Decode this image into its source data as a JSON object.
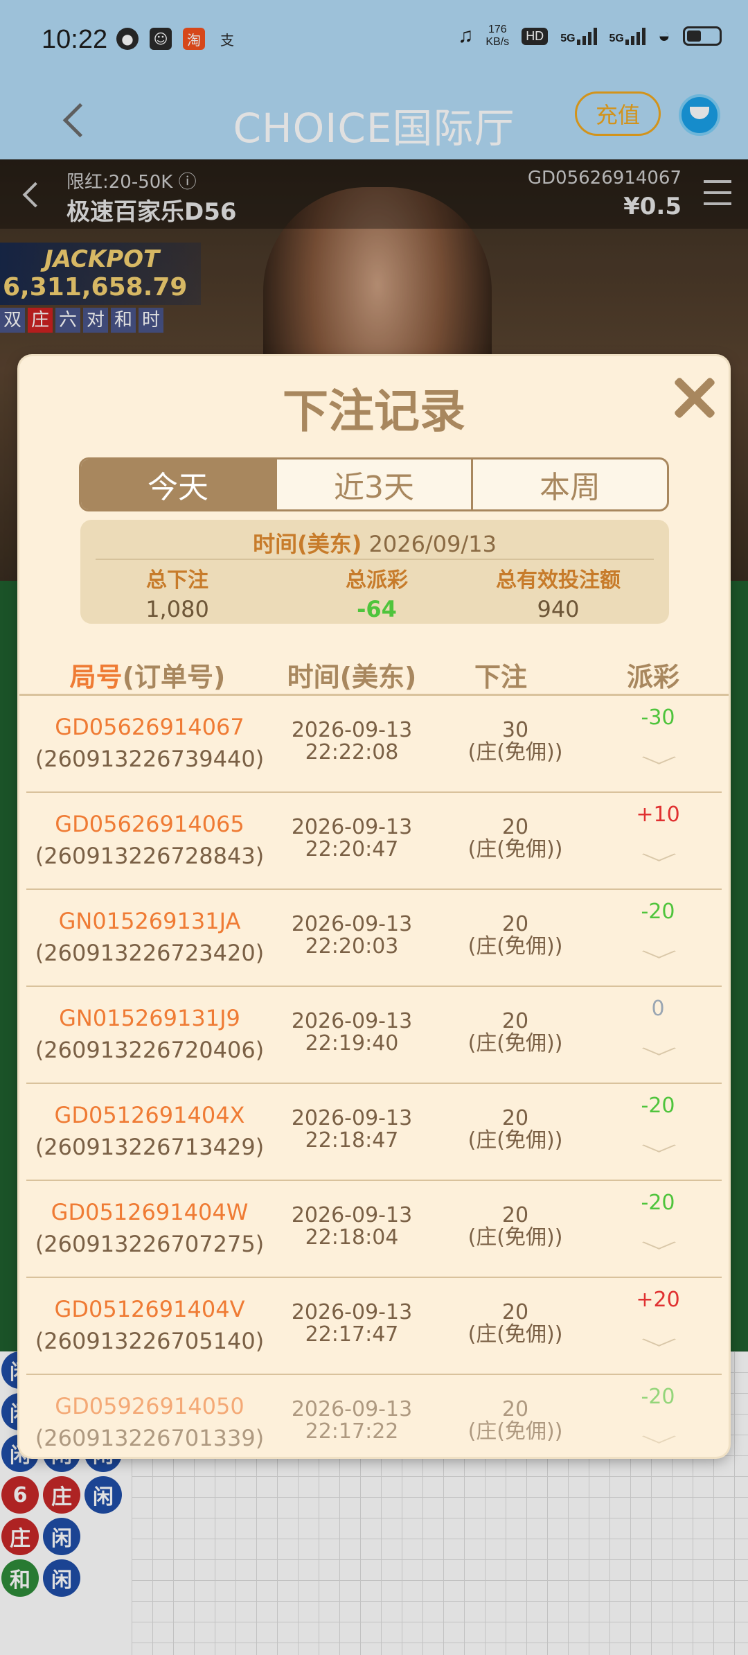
{
  "status_bar": {
    "time": "10:22",
    "net_speed_value": "176",
    "net_speed_unit": "KB/s",
    "hd_label": "HD",
    "signal1": "5G",
    "signal2": "5G"
  },
  "nav": {
    "title": "CHOICE国际厅",
    "recharge_label": "充值"
  },
  "game": {
    "limit": "限红:20-50K ⓘ",
    "table_name": "极速百家乐D56",
    "round_id": "GD05626914067",
    "balance": "¥0.5",
    "jackpot_label": "JACKPOT",
    "jackpot_amount": "6,311,658.79",
    "bet_tags": [
      "双",
      "庄",
      "六",
      "对",
      "和",
      "时"
    ]
  },
  "modal": {
    "title": "下注记录",
    "tabs": [
      "今天",
      "近3天",
      "本周"
    ],
    "summary": {
      "time_label": "时间(美东)",
      "date": "2026/09/13",
      "total_bet_label": "总下注",
      "total_bet": "1,080",
      "total_payout_label": "总派彩",
      "total_payout": "-64",
      "total_valid_label": "总有效投注额",
      "total_valid": "940"
    },
    "headers": {
      "id_highlight": "局号",
      "id_rest": "(订单号)",
      "time": "时间(美东)",
      "bet": "下注",
      "payout": "派彩"
    },
    "rows": [
      {
        "game_id": "GD05626914067",
        "order_id": "(260913226739440)",
        "date": "2026-09-13",
        "time": "22:22:08",
        "amount": "30",
        "bet_type": "(庄(免佣))",
        "payout": "-30",
        "kind": "neg"
      },
      {
        "game_id": "GD05626914065",
        "order_id": "(260913226728843)",
        "date": "2026-09-13",
        "time": "22:20:47",
        "amount": "20",
        "bet_type": "(庄(免佣))",
        "payout": "+10",
        "kind": "pos"
      },
      {
        "game_id": "GN015269131JA",
        "order_id": "(260913226723420)",
        "date": "2026-09-13",
        "time": "22:20:03",
        "amount": "20",
        "bet_type": "(庄(免佣))",
        "payout": "-20",
        "kind": "neg"
      },
      {
        "game_id": "GN015269131J9",
        "order_id": "(260913226720406)",
        "date": "2026-09-13",
        "time": "22:19:40",
        "amount": "20",
        "bet_type": "(庄(免佣))",
        "payout": "0",
        "kind": "zero"
      },
      {
        "game_id": "GD0512691404X",
        "order_id": "(260913226713429)",
        "date": "2026-09-13",
        "time": "22:18:47",
        "amount": "20",
        "bet_type": "(庄(免佣))",
        "payout": "-20",
        "kind": "neg"
      },
      {
        "game_id": "GD0512691404W",
        "order_id": "(260913226707275)",
        "date": "2026-09-13",
        "time": "22:18:04",
        "amount": "20",
        "bet_type": "(庄(免佣))",
        "payout": "-20",
        "kind": "neg"
      },
      {
        "game_id": "GD0512691404V",
        "order_id": "(260913226705140)",
        "date": "2026-09-13",
        "time": "22:17:47",
        "amount": "20",
        "bet_type": "(庄(免佣))",
        "payout": "+20",
        "kind": "pos"
      },
      {
        "game_id": "GD05926914050",
        "order_id": "(260913226701339)",
        "date": "2026-09-13",
        "time": "22:17:22",
        "amount": "20",
        "bet_type": "(庄(免佣))",
        "payout": "-20",
        "kind": "neg"
      }
    ]
  },
  "colors": {
    "accent": "#a8875e",
    "orange": "#ef7b34",
    "negative": "#4fc43c",
    "positive": "#e03131",
    "zero": "#9aa6b3"
  }
}
